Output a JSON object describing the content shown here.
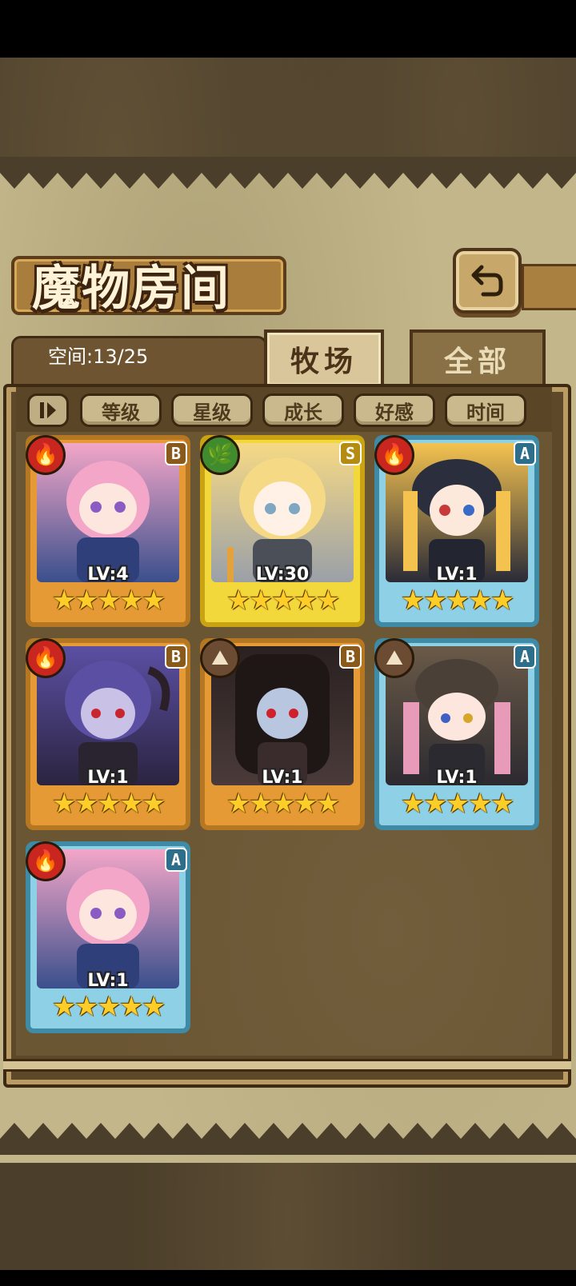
{
  "title": "魔物房间",
  "space_label": "空间:13/25",
  "tabs": [
    {
      "label": "牧场",
      "active": true
    },
    {
      "label": "全部",
      "active": false
    }
  ],
  "filters": [
    "等级",
    "星级",
    "成长",
    "好感",
    "时间"
  ],
  "sort_icon": "ll-sort-toggle-icon",
  "back_icon": "return-arrow-icon",
  "colors": {
    "panel": "#c2b68a",
    "title_text": "#fff3d7",
    "frame_dark": "#3e2a12",
    "star": "#ffcd28"
  },
  "monsters": [
    {
      "level": "LV:4",
      "stars": 5,
      "grade": "B",
      "element": "fire-icon",
      "rarity": "gold",
      "hair": "#f3a6c8"
    },
    {
      "level": "LV:30",
      "stars": 5,
      "grade": "S",
      "element": "leaf-icon",
      "rarity": "yellow",
      "hair": "#f6d985"
    },
    {
      "level": "LV:1",
      "stars": 5,
      "grade": "A",
      "element": "fire-icon",
      "rarity": "blue",
      "hair": "#f4c24f"
    },
    {
      "level": "LV:1",
      "stars": 5,
      "grade": "B",
      "element": "fire-icon",
      "rarity": "gold",
      "hair": "#5b4fa3"
    },
    {
      "level": "LV:1",
      "stars": 5,
      "grade": "B",
      "element": "earth-icon",
      "rarity": "gold",
      "hair": "#2a2120"
    },
    {
      "level": "LV:1",
      "stars": 5,
      "grade": "A",
      "element": "earth-icon",
      "rarity": "blue",
      "hair": "#e79bb8"
    },
    {
      "level": "LV:1",
      "stars": 5,
      "grade": "A",
      "element": "fire-icon",
      "rarity": "blue",
      "hair": "#f3a6c8"
    }
  ]
}
